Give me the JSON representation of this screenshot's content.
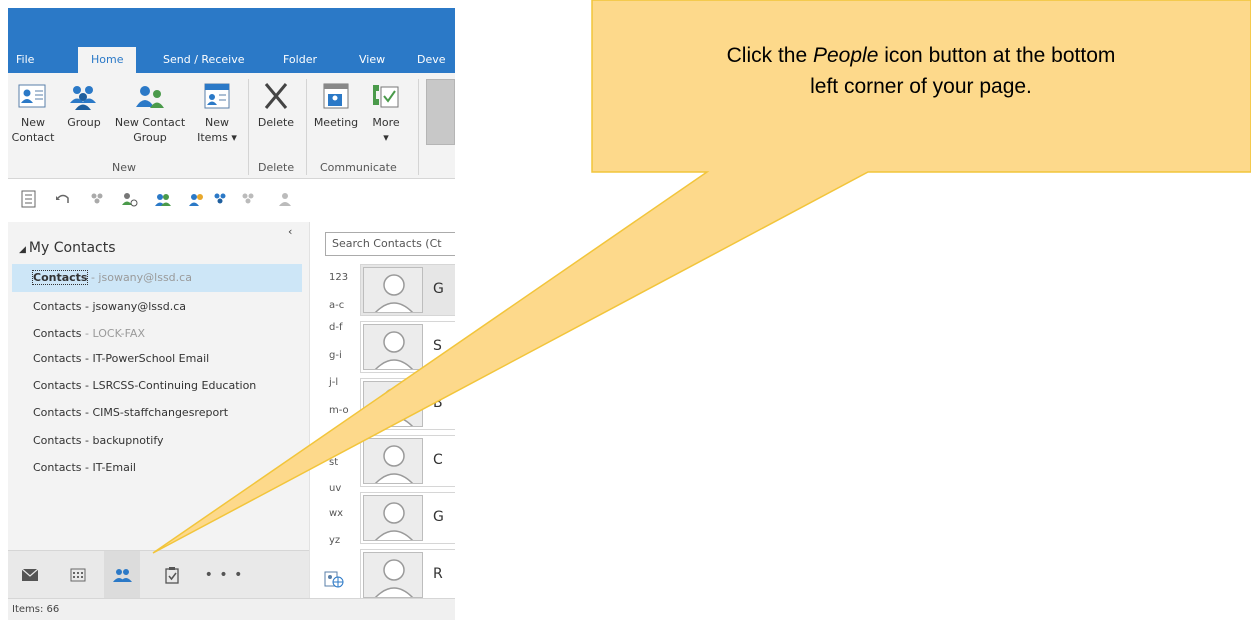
{
  "ribbon": {
    "tabs": [
      {
        "label": "File"
      },
      {
        "label": "Home"
      },
      {
        "label": "Send / Receive"
      },
      {
        "label": "Folder"
      },
      {
        "label": "View"
      },
      {
        "label": "Deve"
      }
    ],
    "buttons": {
      "new_contact": "New\nContact",
      "new_group": "Group",
      "new_contact_group": "New Contact\nGroup",
      "new_items": "New\nItems ▾",
      "delete": "Delete",
      "meeting": "Meeting",
      "more": "More\n▾"
    },
    "groups": {
      "new": "New",
      "delete": "Delete",
      "communicate": "Communicate"
    }
  },
  "folder_pane": {
    "header": "My Contacts",
    "items": [
      {
        "main": "Contacts",
        "sub": " - jsowany@lssd.ca",
        "selected": true
      },
      {
        "main": "Contacts - jsowany@lssd.ca",
        "sub": ""
      },
      {
        "main": "Contacts",
        "sub": " - LOCK-FAX"
      },
      {
        "main": "Contacts - IT-PowerSchool Email",
        "sub": ""
      },
      {
        "main": "Contacts - LSRCSS-Continuing Education",
        "sub": ""
      },
      {
        "main": "Contacts - CIMS-staffchangesreport",
        "sub": ""
      },
      {
        "main": "Contacts - backupnotify",
        "sub": ""
      },
      {
        "main": "Contacts - IT-Email",
        "sub": ""
      }
    ]
  },
  "contact_list": {
    "search_placeholder": "Search Contacts (Ct",
    "alpha_index": [
      "123",
      "a-c",
      "d-f",
      "g-i",
      "j-l",
      "m-o",
      "st",
      "uv",
      "wx",
      "yz"
    ],
    "cards": [
      {
        "initial": "G"
      },
      {
        "initial": "S"
      },
      {
        "initial": "B"
      },
      {
        "initial": "C"
      },
      {
        "initial": "G"
      },
      {
        "initial": "R"
      }
    ]
  },
  "nav": {
    "items": [
      "mail-icon",
      "calendar-icon",
      "people-icon",
      "tasks-icon",
      "more-icon"
    ],
    "more_label": "• • •"
  },
  "status": {
    "items": "Items: 66"
  },
  "callout": {
    "line1_pre": "Click the ",
    "line1_em": "People",
    "line1_post": " icon button at the bottom",
    "line2": "left corner of your page.",
    "fill": "#fdd98b",
    "stroke": "#f2c53b"
  }
}
